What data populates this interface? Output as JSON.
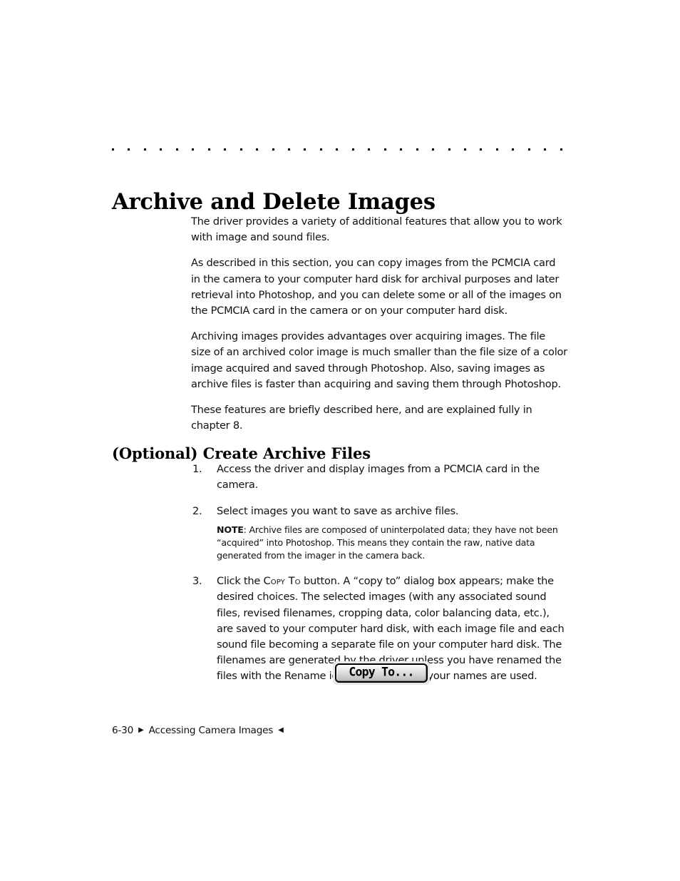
{
  "page": {
    "title": "Archive and Delete Images",
    "subheading": "(Optional) Create Archive Files",
    "dot_count": 29
  },
  "body": {
    "paragraphs": [
      "The driver provides a variety of additional features that allow you to work with image and sound files.",
      "As described in this section, you can copy images from the PCMCIA card in the camera to your computer hard disk for archival purposes and later retrieval into Photoshop, and you can delete some or all of the images on the PCMCIA card in the camera or on your computer hard disk.",
      "Archiving images provides advantages over acquiring images. The file size of an archived color image is much smaller than the file size of a color image acquired and saved through Photoshop. Also, saving images as archive files is faster than acquiring and saving them through Photoshop.",
      "These features are briefly described here, and are explained fully in chapter 8."
    ]
  },
  "steps": [
    {
      "number": "1.",
      "text": "Access the driver and display images from a PCMCIA card in the camera."
    },
    {
      "number": "2.",
      "text": "Select images you want to save as archive files."
    },
    {
      "number": "3.",
      "text_before": "Click the ",
      "button_ref": "Copy To",
      "text_after": " button. A “copy to” dialog box appears; make the desired choices. The selected images (with any associated sound files, revised filenames, cropping data, color balancing data, etc.), are saved to your computer hard disk, with each image file and each sound file becoming a separate file on your computer hard disk. The filenames are generated by the driver unless you have renamed the files with the Rename icon, in which case your names are used."
    }
  ],
  "note": {
    "label": "NOTE",
    "separator": ": ",
    "text": "Archive files are composed of uninterpolated data; they have not been “acquired” into Photoshop. This means they contain the raw, native data generated from the imager in the camera back."
  },
  "copy_to_button": {
    "label": "Copy To..."
  },
  "footer": {
    "page_number": "6-30",
    "left_marker": "▶",
    "section": "Accessing Camera Images",
    "right_marker": "◀"
  },
  "colors": {
    "text": "#111111",
    "page_background": "#ffffff",
    "button_face": "#d8d8d8",
    "button_border": "#000000",
    "button_surround": "#e8e8e8"
  }
}
